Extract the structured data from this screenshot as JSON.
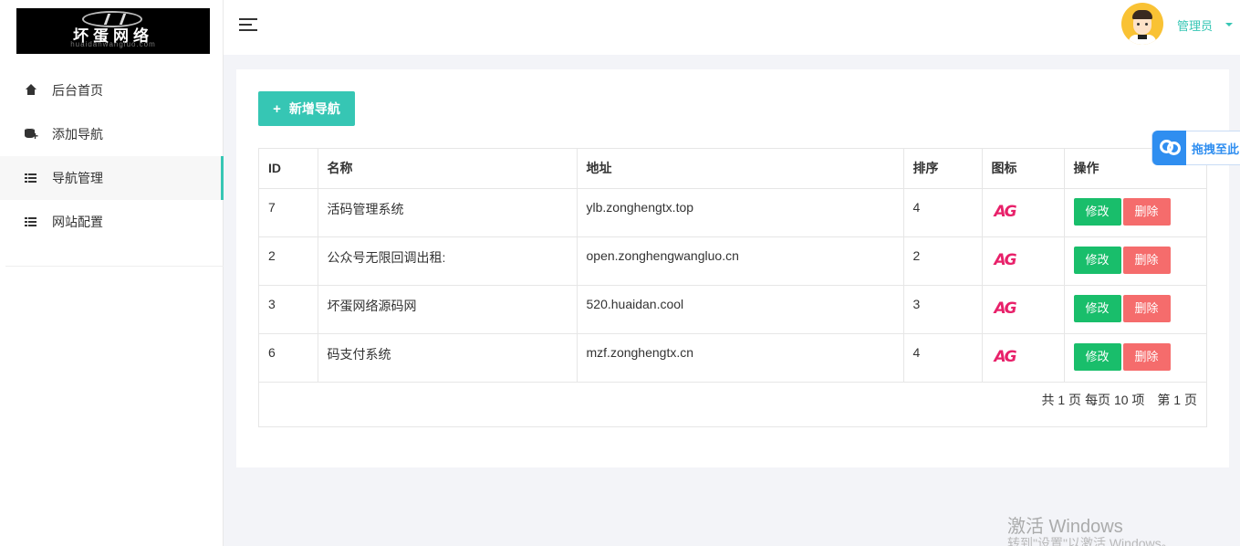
{
  "logo": {
    "title": "坏蛋网络",
    "subtitle": "huaidanwangluo.com"
  },
  "sidebar": {
    "items": [
      {
        "label": "后台首页",
        "icon": "home-icon"
      },
      {
        "label": "添加导航",
        "icon": "database-add-icon"
      },
      {
        "label": "导航管理",
        "icon": "list-icon",
        "active": true
      },
      {
        "label": "网站配置",
        "icon": "list-icon"
      }
    ]
  },
  "header": {
    "user": "管理员"
  },
  "toolbar": {
    "add_label": "新增导航",
    "add_icon": "+"
  },
  "table": {
    "headers": [
      "ID",
      "名称",
      "地址",
      "排序",
      "图标",
      "操作"
    ],
    "rows": [
      {
        "id": "7",
        "name": "活码管理系统",
        "url": "ylb.zonghengtx.top",
        "sort": "4",
        "icon": "AG"
      },
      {
        "id": "2",
        "name": "公众号无限回调出租:",
        "url": "open.zonghengwangluo.cn",
        "sort": "2",
        "icon": "AG"
      },
      {
        "id": "3",
        "name": "坏蛋网络源码网",
        "url": "520.huaidan.cool",
        "sort": "3",
        "icon": "AG"
      },
      {
        "id": "6",
        "name": "码支付系统",
        "url": "mzf.zonghengtx.cn",
        "sort": "4",
        "icon": "AG"
      }
    ],
    "edit_label": "修改",
    "delete_label": "删除"
  },
  "pagination": {
    "total_pages": "共 1 页",
    "per_page": "每页 10 项",
    "current": "第 1 页"
  },
  "widget": {
    "label": "拖拽至此"
  },
  "watermark": {
    "title": "激活 Windows",
    "subtitle": "转到\"设置\"以激活 Windows。"
  },
  "colors": {
    "accent": "#36c6b4",
    "edit": "#19be6b",
    "delete": "#f56c6c",
    "icon": "#e8216a",
    "widget": "#2f8ef0"
  }
}
